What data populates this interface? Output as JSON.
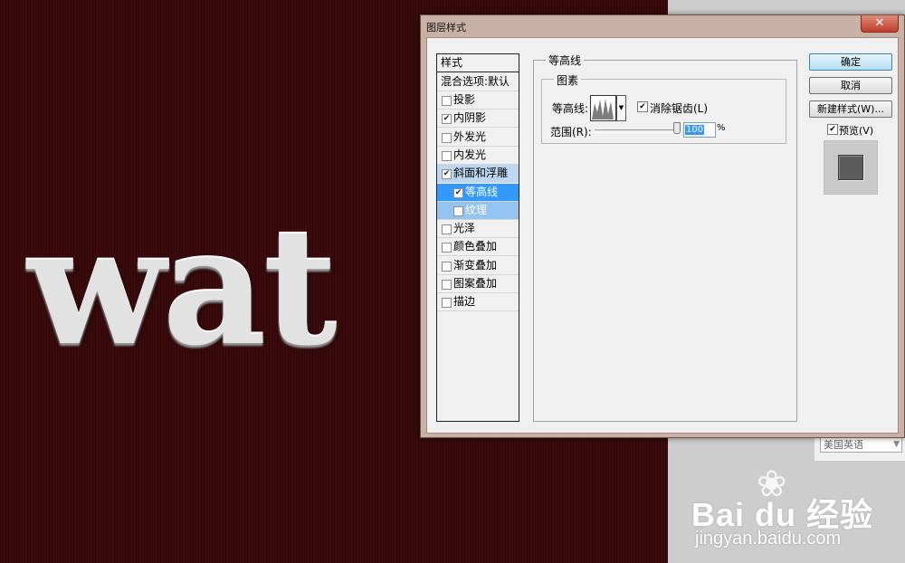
{
  "canvas": {
    "text": "wat"
  },
  "dialog": {
    "title": "图层样式",
    "close_icon": "close-icon",
    "style_list": {
      "header": "样式",
      "blend": "混合选项:默认",
      "items": [
        {
          "label": "投影",
          "checked": false,
          "state": "normal"
        },
        {
          "label": "内阴影",
          "checked": true,
          "state": "normal"
        },
        {
          "label": "外发光",
          "checked": false,
          "state": "normal"
        },
        {
          "label": "内发光",
          "checked": false,
          "state": "normal"
        },
        {
          "label": "斜面和浮雕",
          "checked": true,
          "state": "highlight"
        },
        {
          "label": "等高线",
          "checked": true,
          "state": "selected",
          "sub": true
        },
        {
          "label": "纹理",
          "checked": false,
          "state": "subhighlight",
          "sub": true
        },
        {
          "label": "光泽",
          "checked": false,
          "state": "normal"
        },
        {
          "label": "颜色叠加",
          "checked": false,
          "state": "normal"
        },
        {
          "label": "渐变叠加",
          "checked": false,
          "state": "normal"
        },
        {
          "label": "图案叠加",
          "checked": false,
          "state": "normal"
        },
        {
          "label": "描边",
          "checked": false,
          "state": "normal"
        }
      ]
    },
    "panel": {
      "title": "等高线",
      "group_title": "图素",
      "contour_label": "等高线:",
      "antialias_label": "消除锯齿(L)",
      "antialias_checked": true,
      "range_label": "范围(R):",
      "range_value": "100",
      "range_unit": "%"
    },
    "buttons": {
      "ok": "确定",
      "cancel": "取消",
      "new_style": "新建样式(W)...",
      "preview_label": "预览(V)",
      "preview_checked": true
    }
  },
  "background": {
    "language_select": "美国英语"
  },
  "watermark": {
    "logo": "Bai du 经验",
    "url": "jingyan.baidu.com"
  }
}
